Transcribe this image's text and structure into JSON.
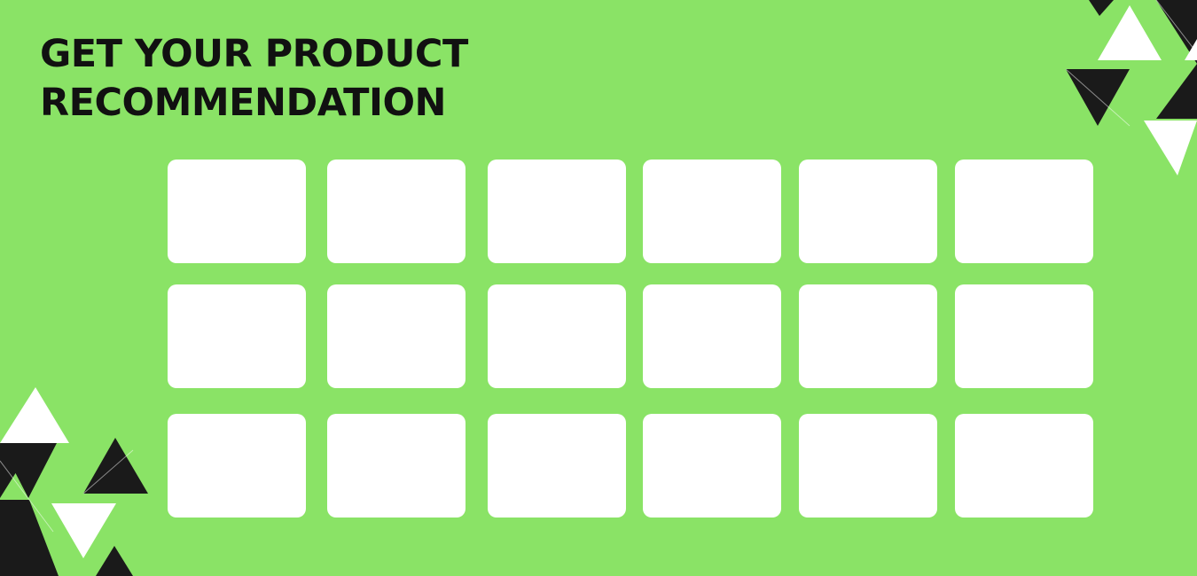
{
  "header": {
    "title_line_1": "GET YOUR PRODUCT",
    "title_line_2": "RECOMMENDATION"
  },
  "grid": {
    "rows": 3,
    "columns": 6,
    "cards": [
      {
        "row": 1,
        "column": 1
      },
      {
        "row": 1,
        "column": 2
      },
      {
        "row": 1,
        "column": 3
      },
      {
        "row": 1,
        "column": 4
      },
      {
        "row": 1,
        "column": 5
      },
      {
        "row": 1,
        "column": 6
      },
      {
        "row": 2,
        "column": 1
      },
      {
        "row": 2,
        "column": 2
      },
      {
        "row": 2,
        "column": 3
      },
      {
        "row": 2,
        "column": 4
      },
      {
        "row": 2,
        "column": 5
      },
      {
        "row": 2,
        "column": 6
      },
      {
        "row": 3,
        "column": 1
      },
      {
        "row": 3,
        "column": 2
      },
      {
        "row": 3,
        "column": 3
      },
      {
        "row": 3,
        "column": 4
      },
      {
        "row": 3,
        "column": 5
      },
      {
        "row": 3,
        "column": 6
      }
    ]
  },
  "colors": {
    "background": "#8ae366",
    "card": "#ffffff",
    "text": "#111111",
    "triangle_dark": "#1a1a1a",
    "triangle_light": "#ffffff"
  },
  "decorations": {
    "top_right": "triangle-pattern",
    "bottom_left": "triangle-pattern"
  }
}
